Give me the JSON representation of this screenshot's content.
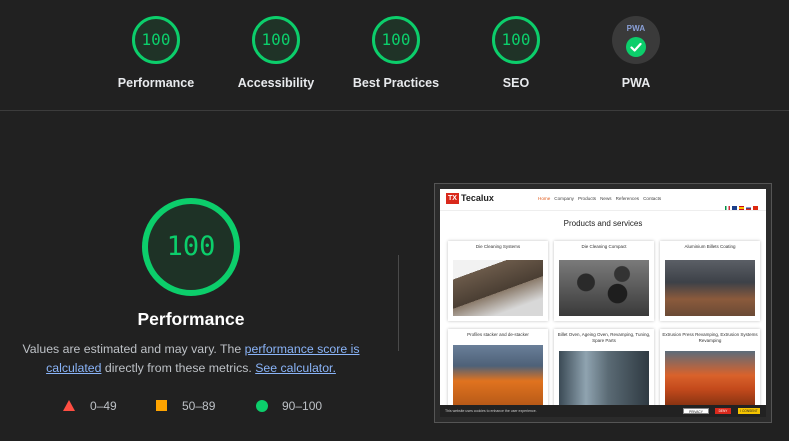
{
  "categories": [
    {
      "label": "Performance",
      "score": "100"
    },
    {
      "label": "Accessibility",
      "score": "100"
    },
    {
      "label": "Best Practices",
      "score": "100"
    },
    {
      "label": "SEO",
      "score": "100"
    },
    {
      "label": "PWA",
      "badge_text": "PWA"
    }
  ],
  "main": {
    "score": "100",
    "title": "Performance",
    "desc_before": "Values are estimated and may vary. The ",
    "link_score": "performance score is calculated",
    "desc_middle": " directly from these metrics. ",
    "link_calculator": "See calculator."
  },
  "legend": [
    {
      "range": "0–49",
      "color": "#ff4e42",
      "icon": "triangle-icon"
    },
    {
      "range": "50–89",
      "color": "#ffa400",
      "icon": "square-icon"
    },
    {
      "range": "90–100",
      "color": "#0cce6b",
      "icon": "circle-icon"
    }
  ],
  "colors": {
    "pass": "#0cce6b",
    "background": "#212121",
    "link": "#8ab4f8"
  },
  "screenshot": {
    "brand": "Tecalux",
    "logo_mark": "TX",
    "menu": [
      "Home",
      "Company",
      "Products",
      "News",
      "References",
      "Contacts"
    ],
    "heading": "Products and services",
    "cards": [
      "Die Cleaning Systems",
      "Die Cleaning Compact",
      "Aluminium Billets Coating",
      "Profiles stacker and de-stacker",
      "Billet Oven, Ageing Oven, Revamping, Tuning, Spare Parts",
      "Extrusion Press Revamping, Extrusion Systems Revamping"
    ],
    "cookie_text": "This website uses cookies to enhance the user experience.",
    "cookie_buttons": [
      "PRIVACY",
      "DENY",
      "I CONSENT"
    ]
  }
}
